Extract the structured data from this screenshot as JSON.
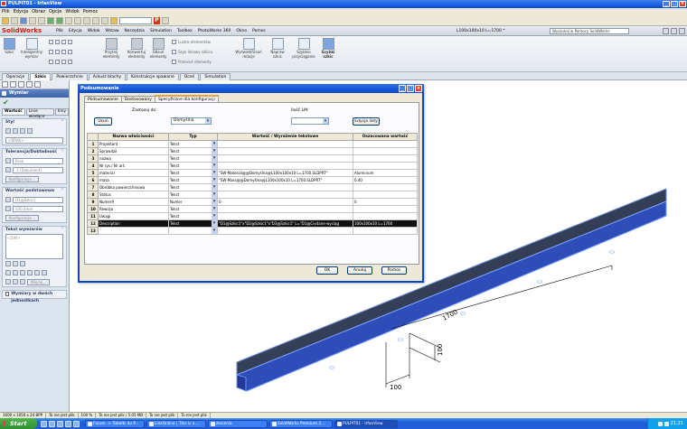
{
  "irfanview": {
    "title": "PULPIT01 - IrfanView",
    "menu": [
      "Plik",
      "Edycja",
      "Obraz",
      "Opcje",
      "Widok",
      "Pomoc"
    ]
  },
  "solidworks": {
    "logo": "SolidWorks",
    "menus": [
      "Plik",
      "Edycja",
      "Widok",
      "Wstaw",
      "Narzędzia",
      "Simulation",
      "Toolbox",
      "PhotoWorks 360",
      "Okno",
      "Pomoc"
    ],
    "doc_title": "L100x100x10 L=1700 *",
    "search_placeholder": "Wyszukaj w Pomocy SolidWorks",
    "commands": [
      {
        "label": "Szkic"
      },
      {
        "label": "Inteligentny wymiar"
      },
      {
        "label": "Przytnij elementy"
      },
      {
        "label": "Konwertuj elementy"
      },
      {
        "label": "Odsuń elementy"
      },
      {
        "label": "Lustro elementów"
      },
      {
        "label": "Szyk liniowy szkicu"
      },
      {
        "label": "Przenieś elementy"
      },
      {
        "label": "Wyświetl/Usuń relacje"
      },
      {
        "label": "Napraw szkic"
      },
      {
        "label": "Szybkie przyciąganie"
      },
      {
        "label": "Szybki szkic"
      }
    ],
    "tabs": [
      "Operacje",
      "Szkic",
      "Powierzchnie",
      "Arkusz blachy",
      "Konstrukcje spawane",
      "Oceń",
      "Simulation"
    ],
    "active_tab": "Szkic"
  },
  "property_manager": {
    "title": "Wymiar",
    "tabs": [
      "Wartość",
      "Linie wiodące",
      "Inny"
    ],
    "sections": {
      "style": {
        "title": "Styl",
        "value": "<BRAK>"
      },
      "tolerance": {
        "title": "Tolerancja/Dokładność",
        "tol_value": "Brak",
        "precision_value": ".1 (Dokument)",
        "config_btn": "Konfiguracje..."
      },
      "primary_value": {
        "title": "Wartość podstawowa",
        "name_value": "D1@Szkic1",
        "dim_value": "100.0mm",
        "config_btn": "Konfiguracje..."
      },
      "dim_text": {
        "title": "Tekst wymiarów",
        "placeholder": "<DIM>",
        "more_btn": "Więcej..."
      },
      "dual": {
        "label": "Wymiary w dwóch jednostkach"
      }
    }
  },
  "dialog": {
    "title": "Podsumowanie",
    "tabs": [
      "Podsumowanie",
      "Dostosowany",
      "Specyficzne dla konfiguracji"
    ],
    "active_tab": "Specyficzne dla konfiguracji",
    "apply_to_label": "Zastosuj do:",
    "apply_to_value": "Domyślna",
    "delete_btn": "Usuń",
    "bom_label": "Ilość LM:",
    "bom_value": "",
    "edit_list_btn": "Edycja listy",
    "columns": [
      "",
      "Nazwa właściwości",
      "Typ",
      "Wartość / Wyrażenie tekstowe",
      "Oszacowana wartość"
    ],
    "rows": [
      {
        "n": "1",
        "name": "Projektant",
        "type": "Tekst",
        "value": "",
        "evaluated": ""
      },
      {
        "n": "2",
        "name": "Sprawdził",
        "type": "Tekst",
        "value": "",
        "evaluated": ""
      },
      {
        "n": "3",
        "name": "nazwa",
        "type": "Tekst",
        "value": "",
        "evaluated": ""
      },
      {
        "n": "4",
        "name": "Nr rys./ Nr art.",
        "type": "Tekst",
        "value": "",
        "evaluated": ""
      },
      {
        "n": "5",
        "name": "material",
        "type": "Tekst",
        "value": "\"SW-Material@@Domyślna@L100x100x10 L=1700.SLDPRT\"",
        "evaluated": "Aluminium"
      },
      {
        "n": "6",
        "name": "masa",
        "type": "Tekst",
        "value": "\"SW-Mass@@Domyślna@L100x100x10 L=1700.SLDPRT\"",
        "evaluated": "0.40"
      },
      {
        "n": "7",
        "name": "Obróbka powierzchniowa",
        "type": "Tekst",
        "value": "",
        "evaluated": ""
      },
      {
        "n": "8",
        "name": "Status",
        "type": "Tekst",
        "value": "",
        "evaluated": ""
      },
      {
        "n": "9",
        "name": "Numer9",
        "type": "Numer",
        "value": "0",
        "evaluated": "0"
      },
      {
        "n": "10",
        "name": "Rewizja",
        "type": "Tekst",
        "value": "",
        "evaluated": ""
      },
      {
        "n": "11",
        "name": "Uwagi",
        "type": "Tekst",
        "value": "",
        "evaluated": ""
      },
      {
        "n": "12",
        "name": "Description",
        "type": "Tekst",
        "value": "\"D1@Szkic1\"x\"D2@Szkic1\"x\"D3@Szkic1\" L=\"D1@Civdane-wyciąg",
        "evaluated": "100x100x10 L=1700"
      },
      {
        "n": "13",
        "name": "",
        "type": "",
        "value": "",
        "evaluated": ""
      }
    ],
    "selected_row": 12,
    "ok_btn": "OK",
    "cancel_btn": "Anuluj",
    "help_btn": "Pomoc"
  },
  "model": {
    "dim_length": "1700",
    "dim_a": "100",
    "dim_b": "100",
    "color": "#2f4db8"
  },
  "statusbar": [
    "1600 x 1050 x 24 BPP",
    "To nie jest plik",
    "100 %",
    "To nie jest plik / 5.05 MB",
    "To nie jest plik",
    "To nie jest plik"
  ],
  "taskbar": {
    "start": "Start",
    "tasks": [
      {
        "label": "Forum -> Tabelki do P..."
      },
      {
        "label": "LinkOnline | This is a ..."
      },
      {
        "label": "zlecenia"
      },
      {
        "label": "SolidWorks Premium 2..."
      },
      {
        "label": "PULPIT01 - IrfanView"
      }
    ],
    "clock": "21:21"
  }
}
